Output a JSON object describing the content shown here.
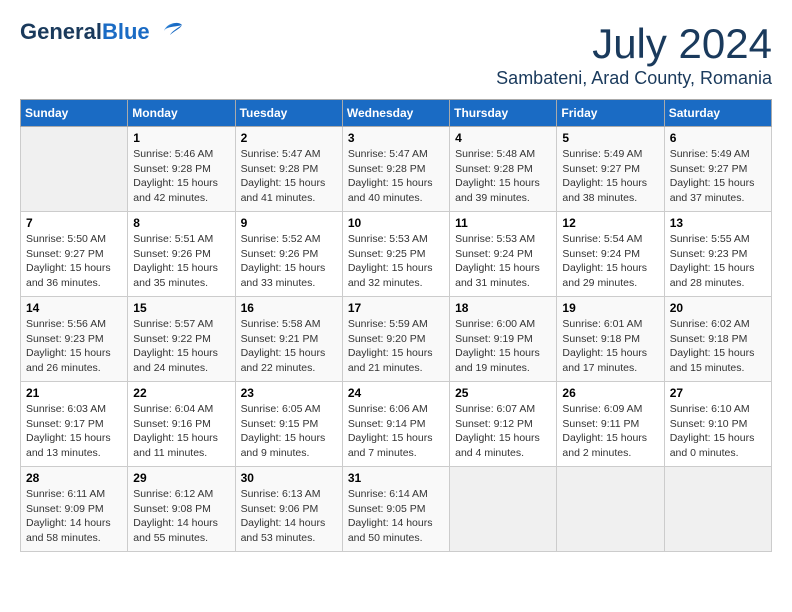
{
  "header": {
    "logo_line1": "General",
    "logo_line2": "Blue",
    "month_title": "July 2024",
    "subtitle": "Sambateni, Arad County, Romania"
  },
  "calendar": {
    "days_of_week": [
      "Sunday",
      "Monday",
      "Tuesday",
      "Wednesday",
      "Thursday",
      "Friday",
      "Saturday"
    ],
    "weeks": [
      [
        {
          "number": "",
          "info": ""
        },
        {
          "number": "1",
          "info": "Sunrise: 5:46 AM\nSunset: 9:28 PM\nDaylight: 15 hours\nand 42 minutes."
        },
        {
          "number": "2",
          "info": "Sunrise: 5:47 AM\nSunset: 9:28 PM\nDaylight: 15 hours\nand 41 minutes."
        },
        {
          "number": "3",
          "info": "Sunrise: 5:47 AM\nSunset: 9:28 PM\nDaylight: 15 hours\nand 40 minutes."
        },
        {
          "number": "4",
          "info": "Sunrise: 5:48 AM\nSunset: 9:28 PM\nDaylight: 15 hours\nand 39 minutes."
        },
        {
          "number": "5",
          "info": "Sunrise: 5:49 AM\nSunset: 9:27 PM\nDaylight: 15 hours\nand 38 minutes."
        },
        {
          "number": "6",
          "info": "Sunrise: 5:49 AM\nSunset: 9:27 PM\nDaylight: 15 hours\nand 37 minutes."
        }
      ],
      [
        {
          "number": "7",
          "info": "Sunrise: 5:50 AM\nSunset: 9:27 PM\nDaylight: 15 hours\nand 36 minutes."
        },
        {
          "number": "8",
          "info": "Sunrise: 5:51 AM\nSunset: 9:26 PM\nDaylight: 15 hours\nand 35 minutes."
        },
        {
          "number": "9",
          "info": "Sunrise: 5:52 AM\nSunset: 9:26 PM\nDaylight: 15 hours\nand 33 minutes."
        },
        {
          "number": "10",
          "info": "Sunrise: 5:53 AM\nSunset: 9:25 PM\nDaylight: 15 hours\nand 32 minutes."
        },
        {
          "number": "11",
          "info": "Sunrise: 5:53 AM\nSunset: 9:24 PM\nDaylight: 15 hours\nand 31 minutes."
        },
        {
          "number": "12",
          "info": "Sunrise: 5:54 AM\nSunset: 9:24 PM\nDaylight: 15 hours\nand 29 minutes."
        },
        {
          "number": "13",
          "info": "Sunrise: 5:55 AM\nSunset: 9:23 PM\nDaylight: 15 hours\nand 28 minutes."
        }
      ],
      [
        {
          "number": "14",
          "info": "Sunrise: 5:56 AM\nSunset: 9:23 PM\nDaylight: 15 hours\nand 26 minutes."
        },
        {
          "number": "15",
          "info": "Sunrise: 5:57 AM\nSunset: 9:22 PM\nDaylight: 15 hours\nand 24 minutes."
        },
        {
          "number": "16",
          "info": "Sunrise: 5:58 AM\nSunset: 9:21 PM\nDaylight: 15 hours\nand 22 minutes."
        },
        {
          "number": "17",
          "info": "Sunrise: 5:59 AM\nSunset: 9:20 PM\nDaylight: 15 hours\nand 21 minutes."
        },
        {
          "number": "18",
          "info": "Sunrise: 6:00 AM\nSunset: 9:19 PM\nDaylight: 15 hours\nand 19 minutes."
        },
        {
          "number": "19",
          "info": "Sunrise: 6:01 AM\nSunset: 9:18 PM\nDaylight: 15 hours\nand 17 minutes."
        },
        {
          "number": "20",
          "info": "Sunrise: 6:02 AM\nSunset: 9:18 PM\nDaylight: 15 hours\nand 15 minutes."
        }
      ],
      [
        {
          "number": "21",
          "info": "Sunrise: 6:03 AM\nSunset: 9:17 PM\nDaylight: 15 hours\nand 13 minutes."
        },
        {
          "number": "22",
          "info": "Sunrise: 6:04 AM\nSunset: 9:16 PM\nDaylight: 15 hours\nand 11 minutes."
        },
        {
          "number": "23",
          "info": "Sunrise: 6:05 AM\nSunset: 9:15 PM\nDaylight: 15 hours\nand 9 minutes."
        },
        {
          "number": "24",
          "info": "Sunrise: 6:06 AM\nSunset: 9:14 PM\nDaylight: 15 hours\nand 7 minutes."
        },
        {
          "number": "25",
          "info": "Sunrise: 6:07 AM\nSunset: 9:12 PM\nDaylight: 15 hours\nand 4 minutes."
        },
        {
          "number": "26",
          "info": "Sunrise: 6:09 AM\nSunset: 9:11 PM\nDaylight: 15 hours\nand 2 minutes."
        },
        {
          "number": "27",
          "info": "Sunrise: 6:10 AM\nSunset: 9:10 PM\nDaylight: 15 hours\nand 0 minutes."
        }
      ],
      [
        {
          "number": "28",
          "info": "Sunrise: 6:11 AM\nSunset: 9:09 PM\nDaylight: 14 hours\nand 58 minutes."
        },
        {
          "number": "29",
          "info": "Sunrise: 6:12 AM\nSunset: 9:08 PM\nDaylight: 14 hours\nand 55 minutes."
        },
        {
          "number": "30",
          "info": "Sunrise: 6:13 AM\nSunset: 9:06 PM\nDaylight: 14 hours\nand 53 minutes."
        },
        {
          "number": "31",
          "info": "Sunrise: 6:14 AM\nSunset: 9:05 PM\nDaylight: 14 hours\nand 50 minutes."
        },
        {
          "number": "",
          "info": ""
        },
        {
          "number": "",
          "info": ""
        },
        {
          "number": "",
          "info": ""
        }
      ]
    ]
  }
}
